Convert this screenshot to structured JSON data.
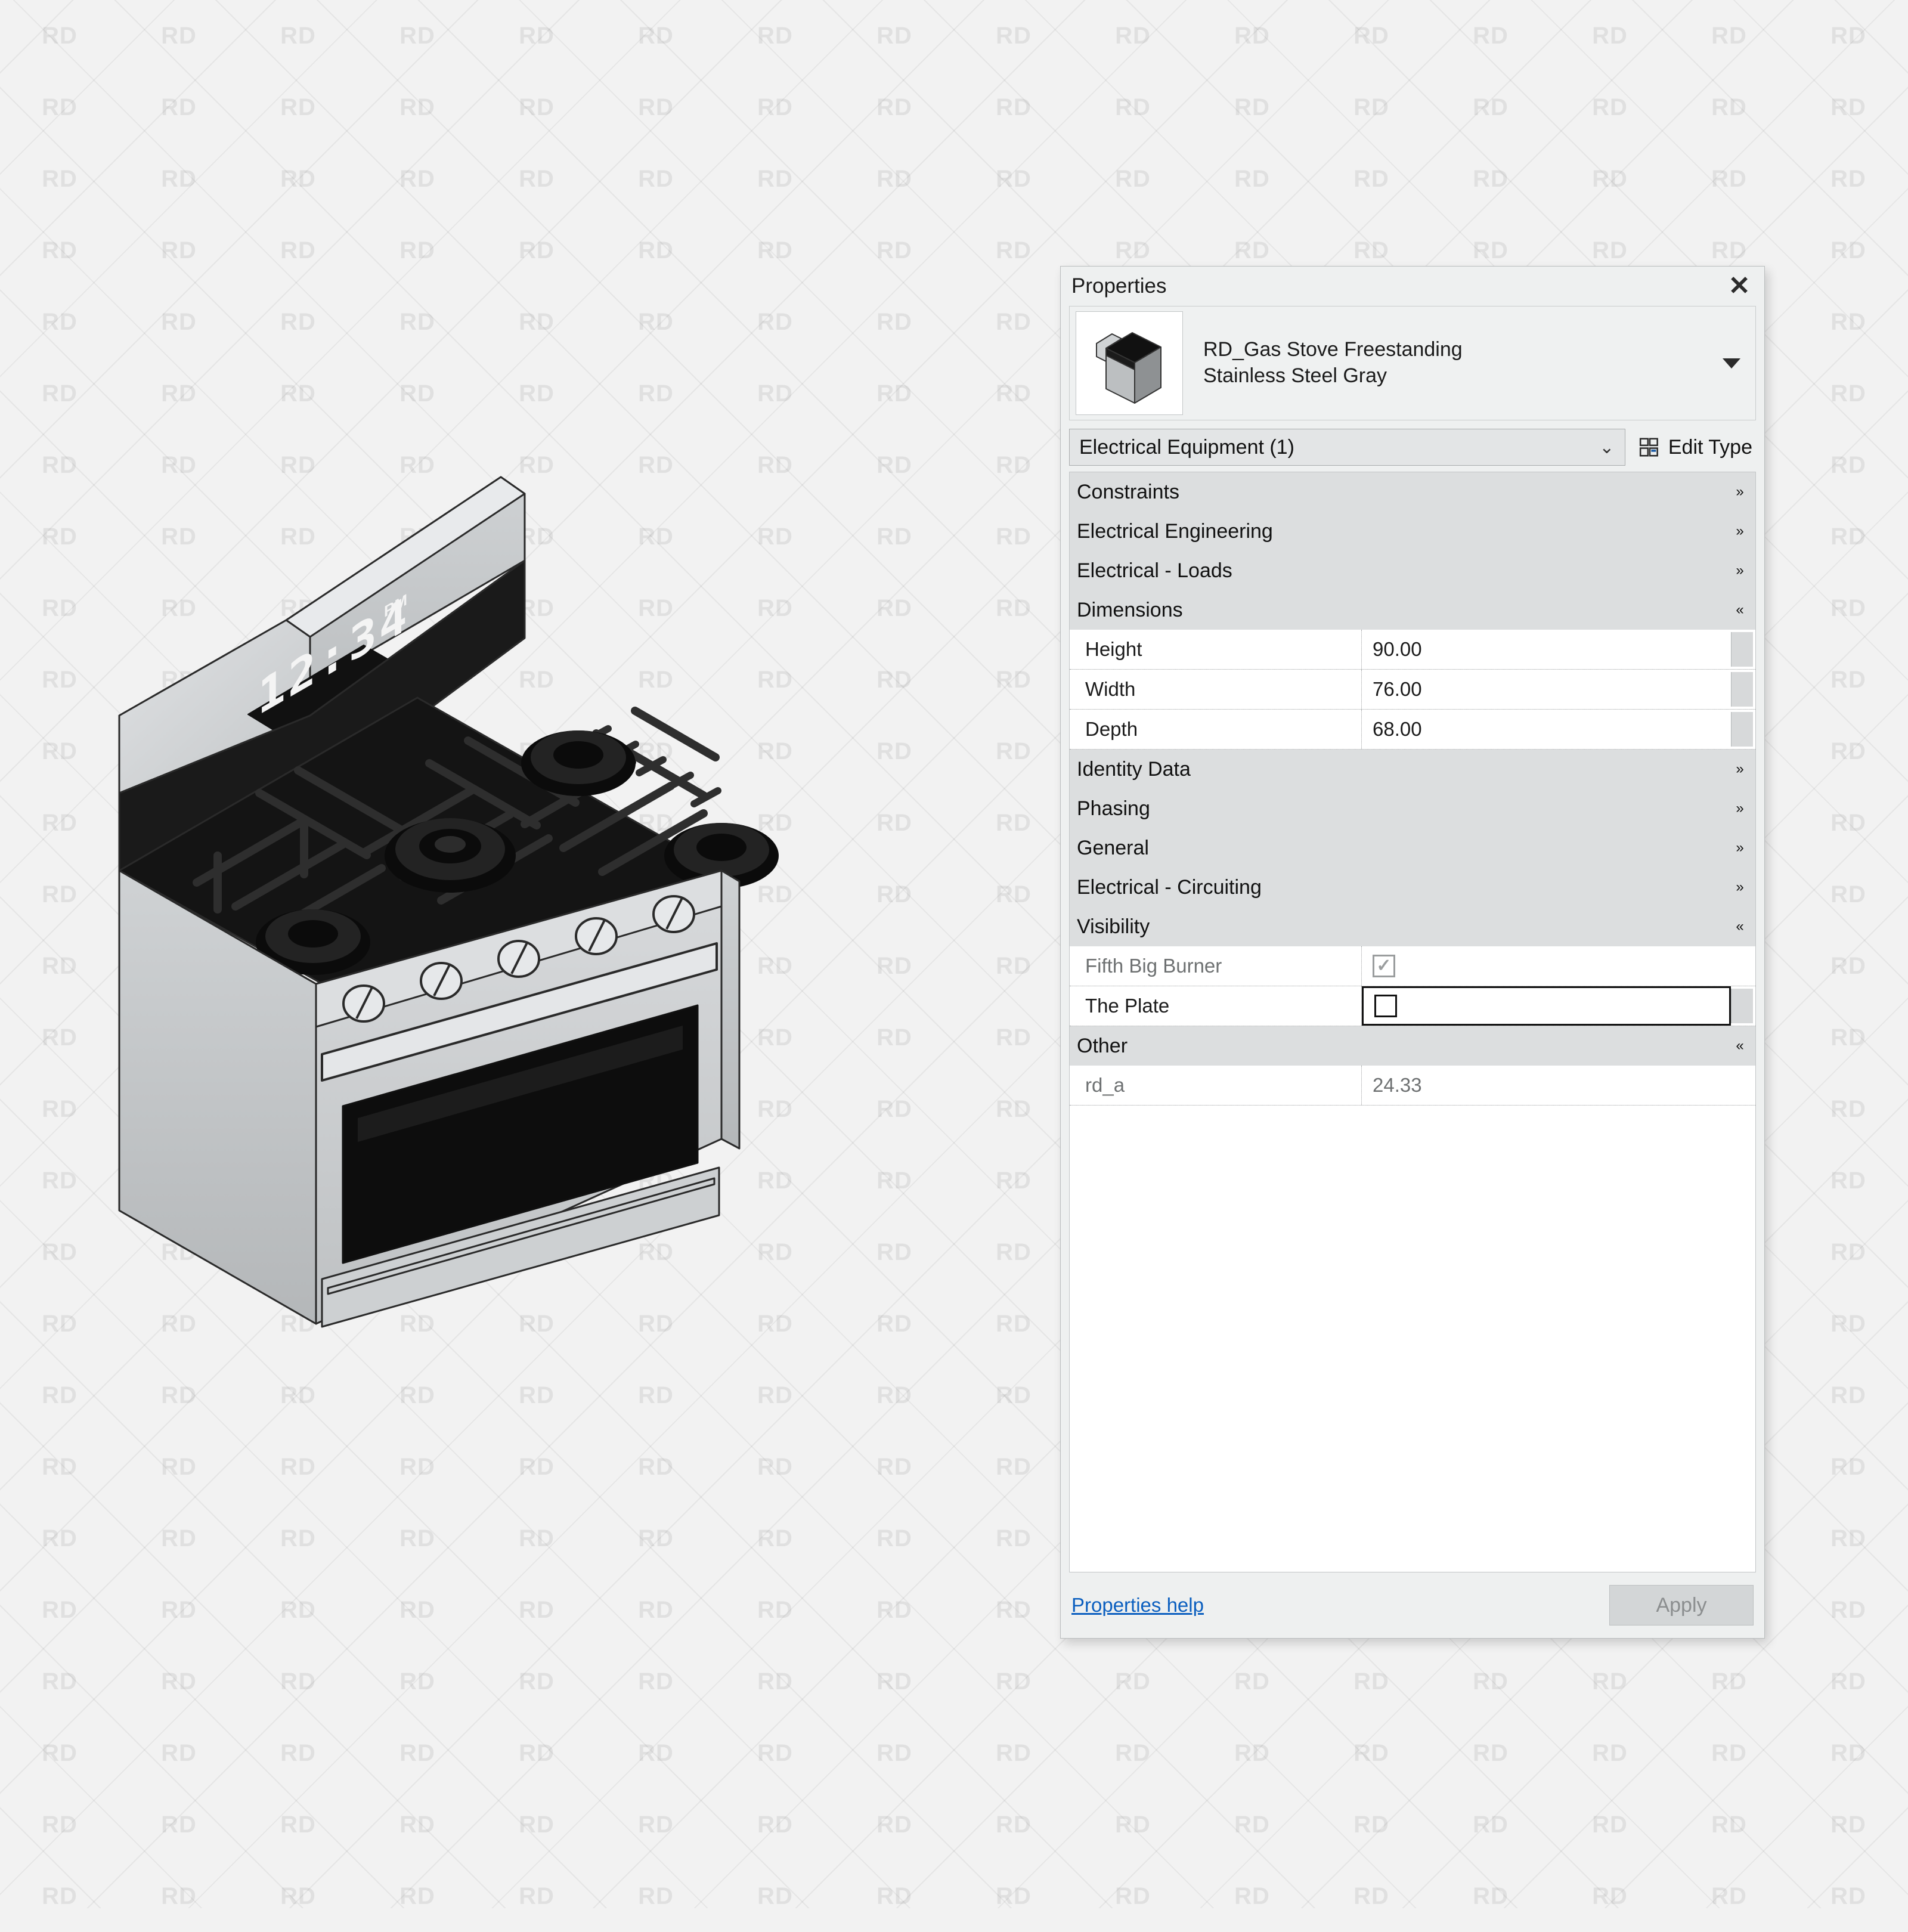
{
  "watermark": {
    "text": "RD"
  },
  "panel": {
    "title": "Properties",
    "close_icon": "close-icon",
    "type_name_line1": "RD_Gas Stove Freestanding",
    "type_name_line2": "Stainless Steel Gray",
    "type_dropdown_icon": "chevron-down-icon",
    "selector_value": "Electrical Equipment (1)",
    "selector_arrow_icon": "chevron-down-icon",
    "edit_type_label": "Edit Type",
    "edit_type_icon": "edit-type-icon",
    "groups": [
      {
        "label": "Constraints",
        "state": "collapsed",
        "chevron": "»"
      },
      {
        "label": "Electrical Engineering",
        "state": "collapsed",
        "chevron": "»"
      },
      {
        "label": "Electrical - Loads",
        "state": "collapsed",
        "chevron": "»"
      },
      {
        "label": "Dimensions",
        "state": "expanded",
        "chevron": "«"
      },
      {
        "label": "Identity Data",
        "state": "collapsed",
        "chevron": "»"
      },
      {
        "label": "Phasing",
        "state": "collapsed",
        "chevron": "»"
      },
      {
        "label": "General",
        "state": "collapsed",
        "chevron": "»"
      },
      {
        "label": "Electrical - Circuiting",
        "state": "collapsed",
        "chevron": "»"
      },
      {
        "label": "Visibility",
        "state": "expanded",
        "chevron": "«"
      },
      {
        "label": "Other",
        "state": "expanded",
        "chevron": "«"
      }
    ],
    "dimensions_rows": [
      {
        "key": "Height",
        "value": "90.00"
      },
      {
        "key": "Width",
        "value": "76.00"
      },
      {
        "key": "Depth",
        "value": "68.00"
      }
    ],
    "visibility_rows": [
      {
        "key": "Fifth Big Burner",
        "checked": true,
        "enabled": false,
        "selected": false
      },
      {
        "key": "The Plate",
        "checked": false,
        "enabled": true,
        "selected": true
      }
    ],
    "other_rows": [
      {
        "key": "rd_a",
        "value": "24.33"
      }
    ],
    "footer": {
      "help_label": "Properties help",
      "apply_label": "Apply",
      "apply_enabled": false
    },
    "colors": {
      "link": "#0b5fbf",
      "group_header_bg": "#dcdedf",
      "panel_bg": "#eef0f0",
      "grid_bg": "#ffffff",
      "disabled_text": "#8b8e8f"
    }
  },
  "viewport": {
    "object_name": "RD_Gas Stove Freestanding Stainless Steel Gray",
    "clock_display": "12:34",
    "clock_meridiem": "PM",
    "burner_count": 5,
    "knob_count": 5,
    "colors": {
      "stainless_light": "#d4d6d8",
      "stainless_mid": "#b9bcbe",
      "stainless_dark": "#9b9ea0",
      "cooktop_black": "#171717",
      "glass_black": "#0d0d0d",
      "outline": "#2a2a2a"
    }
  }
}
